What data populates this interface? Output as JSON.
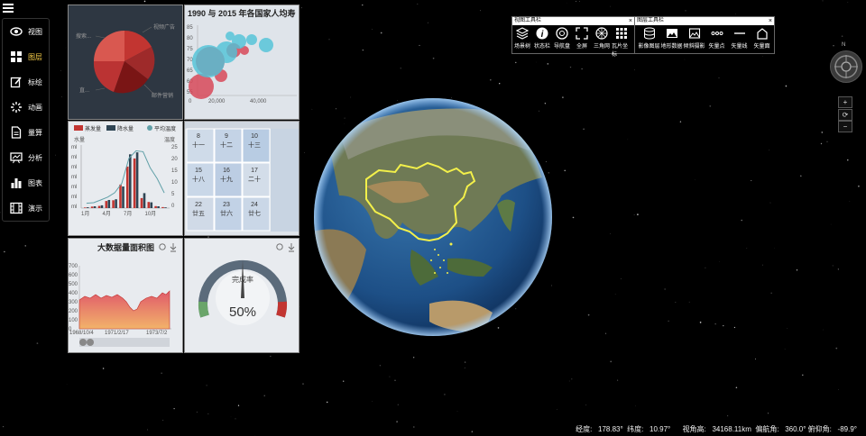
{
  "nav": {
    "items": [
      {
        "label": "视图",
        "icon": "eye-icon"
      },
      {
        "label": "图层",
        "icon": "layers-grid-icon",
        "active": true
      },
      {
        "label": "标绘",
        "icon": "edit-icon"
      },
      {
        "label": "动画",
        "icon": "spinner-icon"
      },
      {
        "label": "量算",
        "icon": "document-icon"
      },
      {
        "label": "分析",
        "icon": "presentation-icon"
      },
      {
        "label": "图表",
        "icon": "bar-chart-icon"
      },
      {
        "label": "演示",
        "icon": "film-icon"
      }
    ]
  },
  "pie": {
    "labels": [
      "搜索...",
      "视频广告",
      "直...",
      "邮件营销"
    ],
    "colors": [
      "#c23531",
      "#b03a3a",
      "#8b1c1c",
      "#d95850",
      "#7a1515"
    ]
  },
  "bubble": {
    "title": "1990 与 2015 年各国家人均寿",
    "yticks": [
      "85",
      "80",
      "75",
      "70",
      "65",
      "60",
      "55"
    ],
    "xticks": [
      "0",
      "20,000",
      "40,000"
    ]
  },
  "bar": {
    "legend": [
      "蒸发量",
      "降水量",
      "平均温度"
    ],
    "ylabel_left": "水量",
    "ylabel_right": "温度",
    "yticks_left": [
      "ml",
      "ml",
      "ml",
      "ml",
      "ml",
      "ml",
      "ml"
    ],
    "yticks_right": [
      "25",
      "20",
      "15",
      "10",
      "5",
      "0"
    ],
    "xticks": [
      "1月",
      "4月",
      "7月",
      "10月"
    ],
    "chart_data": {
      "type": "bar",
      "categories": [
        "1月",
        "2月",
        "3月",
        "4月",
        "5月",
        "6月",
        "7月",
        "8月",
        "9月",
        "10月",
        "11月",
        "12月"
      ],
      "series": [
        {
          "name": "蒸发量",
          "values": [
            2.0,
            4.9,
            7.0,
            23.2,
            25.6,
            76.7,
            135.6,
            162.2,
            32.6,
            20.0,
            6.4,
            3.3
          ]
        },
        {
          "name": "降水量",
          "values": [
            2.6,
            5.9,
            9.0,
            26.4,
            28.7,
            70.7,
            175.6,
            182.2,
            48.7,
            18.8,
            6.0,
            2.3
          ]
        },
        {
          "name": "平均温度",
          "values": [
            2.0,
            2.2,
            3.3,
            4.5,
            6.3,
            10.2,
            20.3,
            23.4,
            23.0,
            16.5,
            12.0,
            6.2
          ]
        }
      ],
      "ylim": [
        0,
        200
      ]
    }
  },
  "calendar": {
    "cells": [
      {
        "day": "8",
        "lunar": "十一"
      },
      {
        "day": "9",
        "lunar": "十二"
      },
      {
        "day": "10",
        "lunar": "十三"
      },
      {
        "day": "15",
        "lunar": "十八"
      },
      {
        "day": "16",
        "lunar": "十九"
      },
      {
        "day": "17",
        "lunar": "二十"
      },
      {
        "day": "22",
        "lunar": "廿五"
      },
      {
        "day": "23",
        "lunar": "廿六"
      },
      {
        "day": "24",
        "lunar": "廿七"
      }
    ]
  },
  "area": {
    "title": "大数据量面积图",
    "yticks": [
      "700",
      "600",
      "500",
      "400",
      "300",
      "200",
      "100",
      "0"
    ],
    "xticks": [
      "1968/10/4",
      "1971/2/17",
      "1973/7/2"
    ]
  },
  "gauge": {
    "label": "完成率",
    "value": "50%",
    "chart_data": {
      "type": "gauge",
      "value": 50,
      "min": 0,
      "max": 100
    }
  },
  "toolbar_view": {
    "title": "视图工具栏",
    "close": "×",
    "items": [
      {
        "label": "场景树",
        "icon": "stack-layers-icon"
      },
      {
        "label": "状态栏",
        "icon": "info-icon"
      },
      {
        "label": "导航盘",
        "icon": "compass-disc-icon"
      },
      {
        "label": "全屏",
        "icon": "fullscreen-icon"
      },
      {
        "label": "三角网",
        "icon": "globe-grid-icon"
      },
      {
        "label": "瓦片坐标",
        "icon": "tile-grid-icon"
      }
    ]
  },
  "toolbar_layer": {
    "title": "图层工具栏",
    "close": "×",
    "items": [
      {
        "label": "影像图层",
        "icon": "database-icon"
      },
      {
        "label": "地形数据",
        "icon": "image-icon"
      },
      {
        "label": "倾斜摄影",
        "icon": "photo-icon"
      },
      {
        "label": "矢量点",
        "icon": "dots-icon"
      },
      {
        "label": "矢量线",
        "icon": "line-icon"
      },
      {
        "label": "矢量面",
        "icon": "house-icon"
      }
    ]
  },
  "compass": {
    "north": "N"
  },
  "zoom": {
    "plus": "+",
    "reset": "⟳",
    "minus": "−"
  },
  "status": {
    "text": "经度:   178.83°  纬度:   10.97°      视角高:   34168.11km  偏航角:   360.0° 俯仰角:   -89.9°"
  }
}
